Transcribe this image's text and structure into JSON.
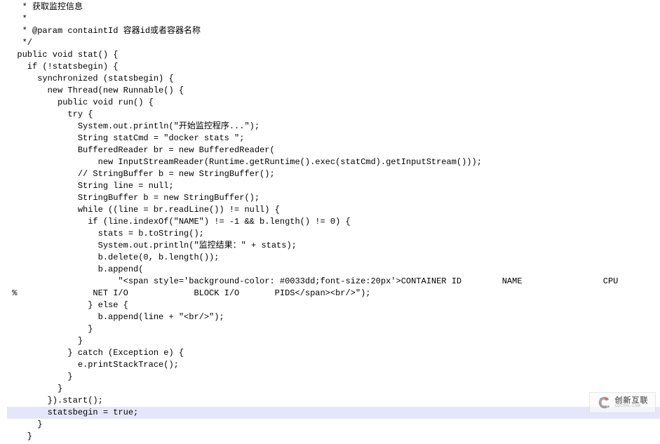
{
  "code": {
    "lines": [
      "   * 获取监控信息",
      "   * ",
      "   * @param containtId 容器id或者容器名称",
      "   */",
      "  public void stat() {",
      "    if (!statsbegin) {",
      "      synchronized (statsbegin) {",
      "        new Thread(new Runnable() {",
      "          public void run() {",
      "            try {",
      "              System.out.println(\"开始监控程序...\");",
      "              String statCmd = \"docker stats \";",
      "              BufferedReader br = new BufferedReader(",
      "                  new InputStreamReader(Runtime.getRuntime().exec(statCmd).getInputStream()));",
      "              // StringBuffer b = new StringBuffer();",
      "              String line = null;",
      "              StringBuffer b = new StringBuffer();",
      "              while ((line = br.readLine()) != null) {",
      "                if (line.indexOf(\"NAME\") != -1 && b.length() != 0) {",
      "                  stats = b.toString();",
      "                  System.out.println(\"监控结果：\" + stats);",
      "                  b.delete(0, b.length());",
      "                  b.append(",
      "                      \"<span style='background-color: #0033dd;font-size:20px'>CONTAINER ID        NAME                CPU",
      " %               NET I/O             BLOCK I/O       PIDS</span><br/>\");",
      "                } else {",
      "                  b.append(line + \"<br/>\");",
      "                }",
      "              }",
      "            } catch (Exception e) {",
      "              e.printStackTrace();",
      "            }",
      "          }",
      "        }).start();",
      "        statsbegin = true;",
      "      }",
      "    }"
    ],
    "highlight_index": 34
  },
  "watermark": {
    "cn": "创新互联",
    "en": "CDCXHL.COM"
  }
}
